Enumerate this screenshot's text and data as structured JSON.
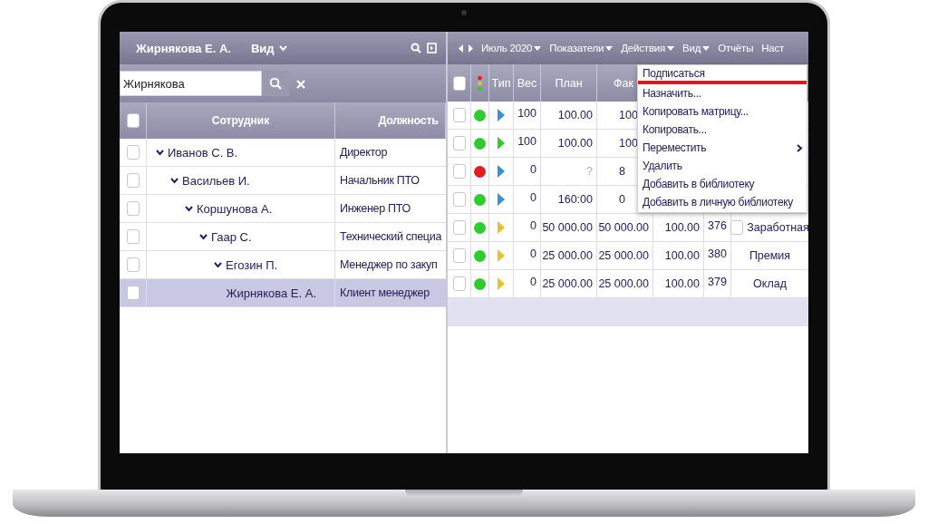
{
  "left_panel": {
    "title": "Жирнякова Е. А.",
    "view_menu": "Вид",
    "search": {
      "value": "Жирнякова"
    },
    "header_checked": false,
    "columns": [
      "Сотрудник",
      "Должность"
    ],
    "employees": [
      {
        "name": "Иванов С. В.",
        "position": "Директор",
        "checked": false,
        "selected": false,
        "expanded": true,
        "children": [
          {
            "name": "Васильев И.",
            "position": "Начальник ПТО",
            "checked": false,
            "selected": false,
            "expanded": true,
            "children": [
              {
                "name": "Коршунова А.",
                "position": "Инженер ПТО",
                "checked": false,
                "selected": false,
                "expanded": true,
                "children": [
                  {
                    "name": "Гаар С.",
                    "position": "Технический специа",
                    "checked": false,
                    "selected": false,
                    "expanded": true,
                    "children": [
                      {
                        "name": "Егозин П.",
                        "position": "Менеджер по закуп",
                        "checked": false,
                        "selected": false,
                        "expanded": true,
                        "children": [
                          {
                            "name": "Жирнякова Е. А.",
                            "position": "Клиент менеджер",
                            "checked": false,
                            "selected": true
                          }
                        ]
                      }
                    ]
                  }
                ]
              }
            ]
          }
        ]
      }
    ]
  },
  "right_panel": {
    "toolbar": [
      {
        "label": "Июль 2020",
        "dropdown": true
      },
      {
        "label": "Показатели",
        "dropdown": true
      },
      {
        "label": "Действия",
        "dropdown": true
      },
      {
        "label": "Вид",
        "dropdown": true
      },
      {
        "label": "Отчёты",
        "dropdown": false
      },
      {
        "label": "Наст",
        "dropdown": false
      }
    ],
    "header_checked": false,
    "columns": [
      "Тип",
      "Вес",
      "План",
      "Фак"
    ],
    "rows": [
      {
        "checked": false,
        "status": {
          "color": "#2ecc2e"
        },
        "type": {
          "color": "#3a8fd8"
        },
        "weight": "100",
        "plan": "100.00",
        "fact": "100"
      },
      {
        "checked": false,
        "status": {
          "color": "#2ecc2e"
        },
        "type": {
          "color": "#2ecc2e"
        },
        "weight": "100",
        "plan": "100.00",
        "fact": "100"
      },
      {
        "checked": false,
        "status": {
          "color": "#e02020"
        },
        "type": {
          "color": "#3a8fd8"
        },
        "weight": "0",
        "plan": "?",
        "fact": "8"
      },
      {
        "checked": false,
        "status": {
          "color": "#2ecc2e"
        },
        "type": {
          "color": "#3a8fd8"
        },
        "weight": "0",
        "plan": "160:00",
        "fact": "0"
      },
      {
        "checked": false,
        "status": {
          "color": "#2ecc2e"
        },
        "type": {
          "color": "#e8c030"
        },
        "weight": "0",
        "plan": "50 000.00",
        "fact": "50 000.00",
        "column_7": "100.00",
        "column_8": "376",
        "column_9": {
          "kind": "checkbox",
          "text": "Заработная",
          "checked": false
        }
      },
      {
        "checked": false,
        "status": {
          "color": "#2ecc2e"
        },
        "type": {
          "color": "#e8c030"
        },
        "weight": "0",
        "plan": "25 000.00",
        "fact": "25 000.00",
        "column_7": "100.00",
        "column_8": "380",
        "column_9": {
          "kind": "text",
          "text": "Премия"
        }
      },
      {
        "checked": false,
        "status": {
          "color": "#2ecc2e"
        },
        "type": {
          "color": "#e8c030"
        },
        "weight": "0",
        "plan": "25 000.00",
        "fact": "25 000.00",
        "column_7": "100.00",
        "column_8": "379",
        "column_9": {
          "kind": "text",
          "text": "Оклад"
        }
      }
    ],
    "actions_menu": [
      {
        "label": "Подписаться",
        "highlighted": true,
        "submenu": false
      },
      {
        "label": "Назначить...",
        "highlighted": false,
        "submenu": false
      },
      {
        "label": "Копировать матрицу...",
        "highlighted": false,
        "submenu": false
      },
      {
        "label": "Копировать...",
        "highlighted": false,
        "submenu": false
      },
      {
        "label": "Переместить",
        "highlighted": false,
        "submenu": true
      },
      {
        "label": "Удалить",
        "highlighted": false,
        "submenu": false
      },
      {
        "label": "Добавить в библиотеку",
        "highlighted": false,
        "submenu": false
      },
      {
        "label": "Добавить в личную библиотеку",
        "highlighted": false,
        "submenu": false
      }
    ]
  }
}
